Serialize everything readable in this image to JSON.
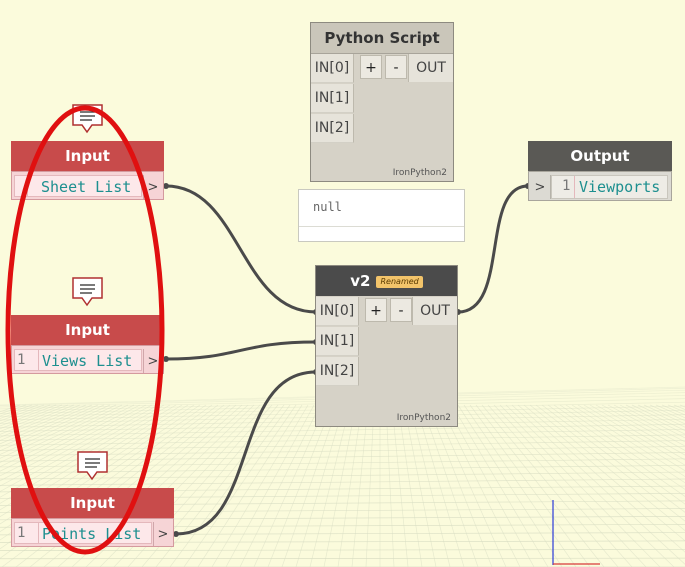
{
  "inputs": [
    {
      "header": "Input",
      "index": "",
      "value": "Sheet List",
      "arrow": ">"
    },
    {
      "header": "Input",
      "index": "1",
      "value": "Views List",
      "arrow": ">"
    },
    {
      "header": "Input",
      "index": "1",
      "value": "Points List",
      "arrow": ">"
    }
  ],
  "python_script": {
    "title": "Python Script",
    "ports": [
      "IN[0]",
      "IN[1]",
      "IN[2]"
    ],
    "plus": "+",
    "minus": "-",
    "out": "OUT",
    "engine": "IronPython2",
    "preview": "null"
  },
  "v2": {
    "title": "v2",
    "badge": "Renamed",
    "ports": [
      "IN[0]",
      "IN[1]",
      "IN[2]"
    ],
    "plus": "+",
    "minus": "-",
    "out": "OUT",
    "engine": "IronPython2"
  },
  "output": {
    "header": "Output",
    "arrow": ">",
    "index": "1",
    "value": "Viewports"
  },
  "colors": {
    "input_header": "#c84b4b",
    "background": "#fbfbdc",
    "highlight_ellipse": "#e01010",
    "wire": "#4a4a4a",
    "value_text": "#1d8f8f"
  },
  "icons": [
    "comment-icon",
    "highlight-ellipse",
    "axis-gizmo"
  ]
}
